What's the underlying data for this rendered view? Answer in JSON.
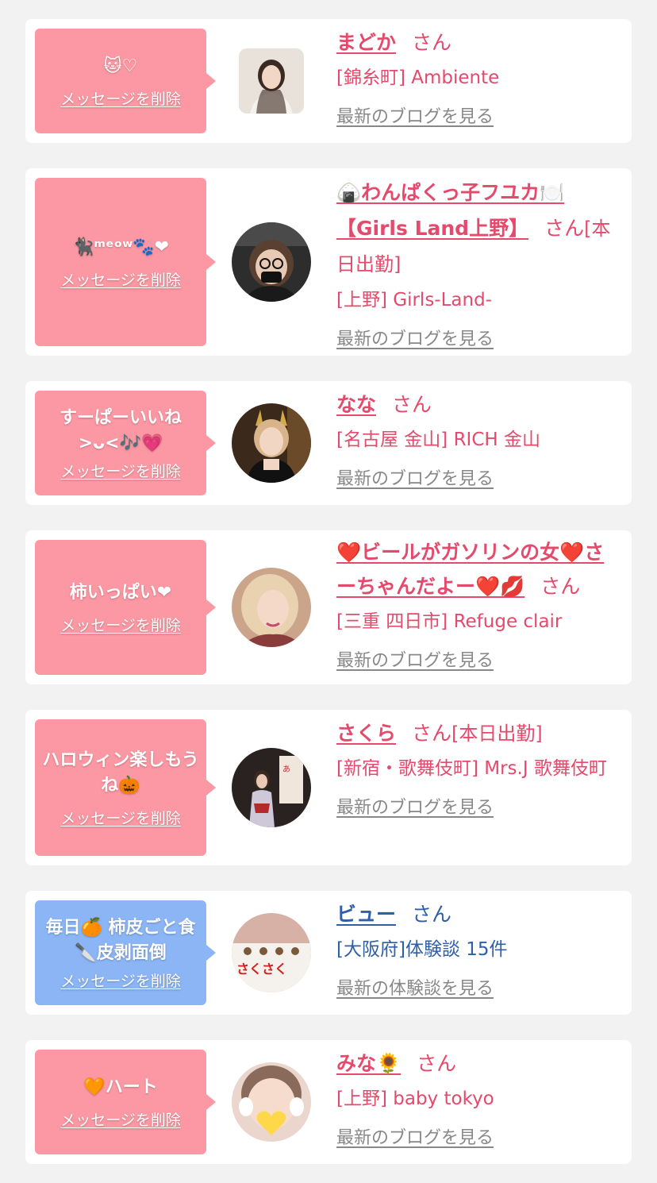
{
  "delete_label": "メッセージを削除",
  "san": "さん",
  "cards": [
    {
      "message": "🐱♡",
      "name": "まどか",
      "suffix": "",
      "shop": "[錦糸町] Ambiente",
      "link": "最新のブログを見る"
    },
    {
      "message": "🐈‍⬛ᵐᵉᵒʷ🐾❤",
      "name": "🍙わんぱくっ子フユカ🍽️【Girls Land上野】",
      "suffix": "[本日出勤]",
      "shop": "[上野] Girls-Land-",
      "link": "最新のブログを見る"
    },
    {
      "message": "すーぱーいいね>ᴗ<🎶💗",
      "name": "なな",
      "suffix": "",
      "shop": "[名古屋 金山] RICH 金山",
      "link": "最新のブログを見る"
    },
    {
      "message": "柿いっぱい❤",
      "name": "❤️ビールがガソリンの女❤️さーちゃんだよー❤️💋",
      "suffix": "",
      "shop": "[三重 四日市] Refuge clair",
      "link": "最新のブログを見る"
    },
    {
      "message": "ハロウィン楽しもうね🎃",
      "name": "さくら",
      "suffix": "[本日出勤]",
      "shop": "[新宿・歌舞伎町] Mrs.J 歌舞伎町",
      "link": "最新のブログを見る"
    },
    {
      "message": "毎日🍊 柿皮ごと食🔪皮剥面倒",
      "name": "ビュー",
      "suffix": "",
      "shop": "[大阪府]体験談 15件",
      "link": "最新の体験談を見る"
    },
    {
      "message": "🧡ハート",
      "name": "みな🌻",
      "suffix": "",
      "shop": "[上野] baby tokyo",
      "link": "最新のブログを見る"
    }
  ],
  "colors": {
    "pink_bubble": "#fc98a3",
    "blue_bubble": "#8bb5f4",
    "pink_text": "#e5496b",
    "blue_text": "#2e5fa8"
  }
}
